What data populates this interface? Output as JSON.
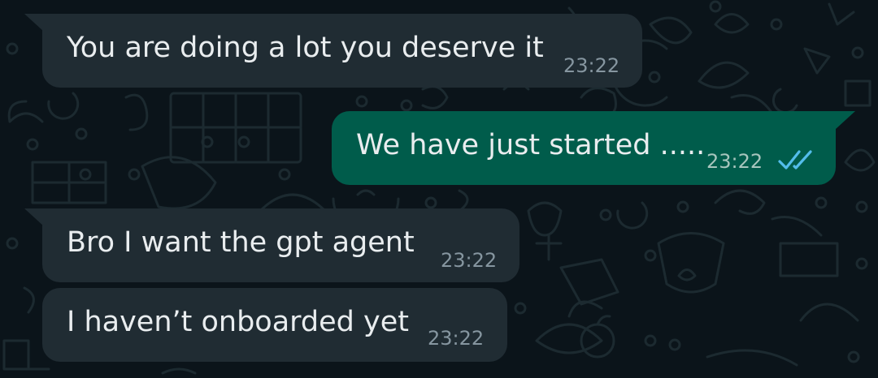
{
  "messages": [
    {
      "direction": "incoming",
      "text": "You are doing a lot you deserve it",
      "time": "23:22"
    },
    {
      "direction": "outgoing",
      "text": "We have just started .....",
      "time": "23:22",
      "status_icon": "double-check-read-icon"
    },
    {
      "direction": "incoming",
      "text": "Bro I want the gpt agent",
      "time": "23:22"
    },
    {
      "direction": "incoming",
      "text": "I haven’t onboarded yet",
      "time": "23:22"
    }
  ],
  "colors": {
    "background": "#0b141a",
    "incoming_bubble": "#202c33",
    "outgoing_bubble": "#005c4b",
    "read_ticks": "#53bdeb",
    "text": "#e9edef"
  }
}
